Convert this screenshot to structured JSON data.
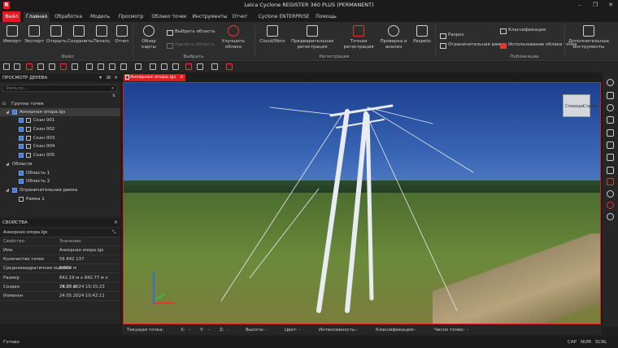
{
  "app": {
    "title": "Leica Cyclone REGISTER 360 PLUS (PERMANENT)"
  },
  "window": {
    "minimize": "–",
    "maximize": "❐",
    "close": "✕"
  },
  "menu": [
    "Файл",
    "Главная",
    "Обработка",
    "Модель",
    "Просмотр",
    "Облако точек",
    "Инструменты",
    "Отчет",
    "Cyclone ENTERPRISE",
    "Помощь"
  ],
  "ribbon": {
    "buttons": [
      "Импорт",
      "Экспорт",
      "Открыть",
      "Сохранить",
      "Печать",
      "Отчет",
      "Обзор карты",
      "Улучшить облака",
      "Cloud/Worx",
      "Предварительная регистрация",
      "Точная регистрация",
      "Проверка и анализ",
      "Paspeto",
      "Дополнительные инструменты"
    ],
    "small": {
      "select_area": "Выбрать область",
      "delete_area": "Удалить область",
      "section": "Разрез",
      "bounding_frame": "Ограничительная рамка",
      "classification": "Классификация",
      "use_clouds": "Использование облака точек"
    },
    "groups": {
      "main": "Файл",
      "select": "Выбрать",
      "registration": "Регистрация",
      "publish": "Публикации"
    }
  },
  "tree": {
    "header": "ПРОСМОТР ДЕРЕВА",
    "filter_placeholder": "Фильтр...",
    "rows": [
      "Группы точек",
      "Анкерная опора.lgs",
      "Скан 001",
      "Скан 002",
      "Скан 003",
      "Скан 004",
      "Скан 005",
      "Области",
      "Область 1",
      "Область 2",
      "Ограничительная рамка",
      "Рамка 1"
    ]
  },
  "properties": {
    "header": "СВОЙСТВА",
    "object": "Анкерная опора.lgs",
    "col_prop": "Свойство",
    "col_val": "Значение",
    "rows": [
      {
        "k": "Имя",
        "v": "Анкерная опора.lgs"
      },
      {
        "k": "Количество точек",
        "v": "56 842 137"
      },
      {
        "k": "Среднеквадратичная ошибка",
        "v": "0.009 м"
      },
      {
        "k": "Размер",
        "v": "842.19 м x 842.77 м x 79.27 м"
      },
      {
        "k": "Создан",
        "v": "24.05.2024 10:15:23"
      },
      {
        "k": "Изменен",
        "v": "24.05.2024 10:42:11"
      }
    ]
  },
  "document": {
    "tab": "Анкерная опора.lgs",
    "tab_close": "×",
    "view_cube_left": "Спереди",
    "view_cube_right": "Справа"
  },
  "statusline": {
    "current_point": "Текущая точка:",
    "x": "X:",
    "y": "Y:",
    "z": "Z:",
    "height": "Высота:",
    "color": "Цвет:",
    "intensity": "Интенсивность:",
    "classification": "Классификация:",
    "count": "Число точек:",
    "dash": "-"
  },
  "statusbar": {
    "ready": "Готово",
    "cap": "CAP",
    "num": "NUM",
    "scrl": "SCRL"
  },
  "colors": {
    "accent": "#e11b22",
    "checkbox": "#3f7cd9"
  }
}
